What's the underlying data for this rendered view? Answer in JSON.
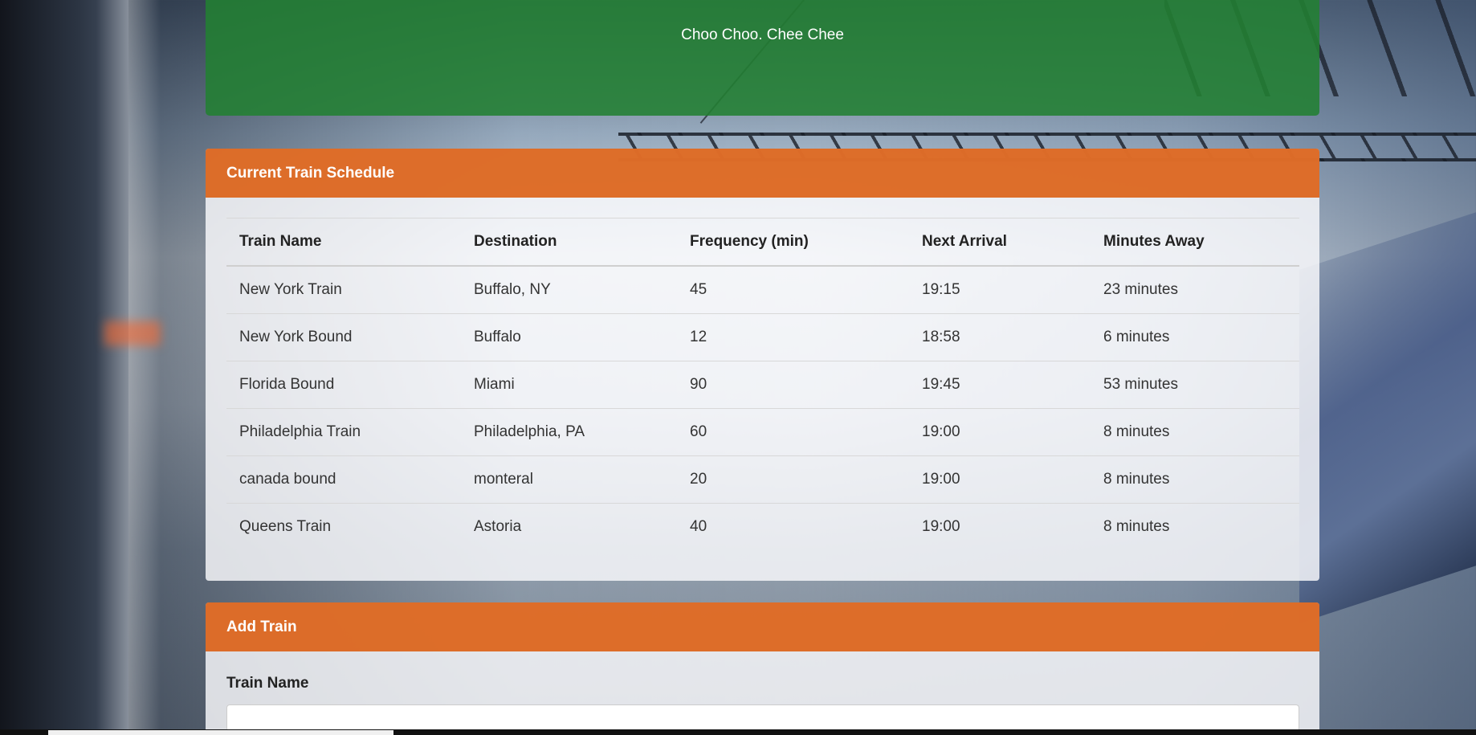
{
  "jumbotron": {
    "subtitle": "Choo Choo. Chee Chee"
  },
  "schedule": {
    "heading": "Current Train Schedule",
    "columns": [
      "Train Name",
      "Destination",
      "Frequency (min)",
      "Next Arrival",
      "Minutes Away"
    ],
    "rows": [
      [
        "New York Train",
        "Buffalo, NY",
        "45",
        "19:15",
        "23 minutes"
      ],
      [
        "New York Bound",
        "Buffalo",
        "12",
        "18:58",
        "6 minutes"
      ],
      [
        "Florida Bound",
        "Miami",
        "90",
        "19:45",
        "53 minutes"
      ],
      [
        "Philadelphia Train",
        "Philadelphia, PA",
        "60",
        "19:00",
        "8 minutes"
      ],
      [
        "canada bound",
        "monteral",
        "20",
        "19:00",
        "8 minutes"
      ],
      [
        "Queens Train",
        "Astoria",
        "40",
        "19:00",
        "8 minutes"
      ]
    ]
  },
  "add_train": {
    "heading": "Add Train",
    "train_name_label": "Train Name",
    "train_name_value": ""
  },
  "colors": {
    "jumbotron": "#228032",
    "panel_heading": "#dc5f14"
  }
}
